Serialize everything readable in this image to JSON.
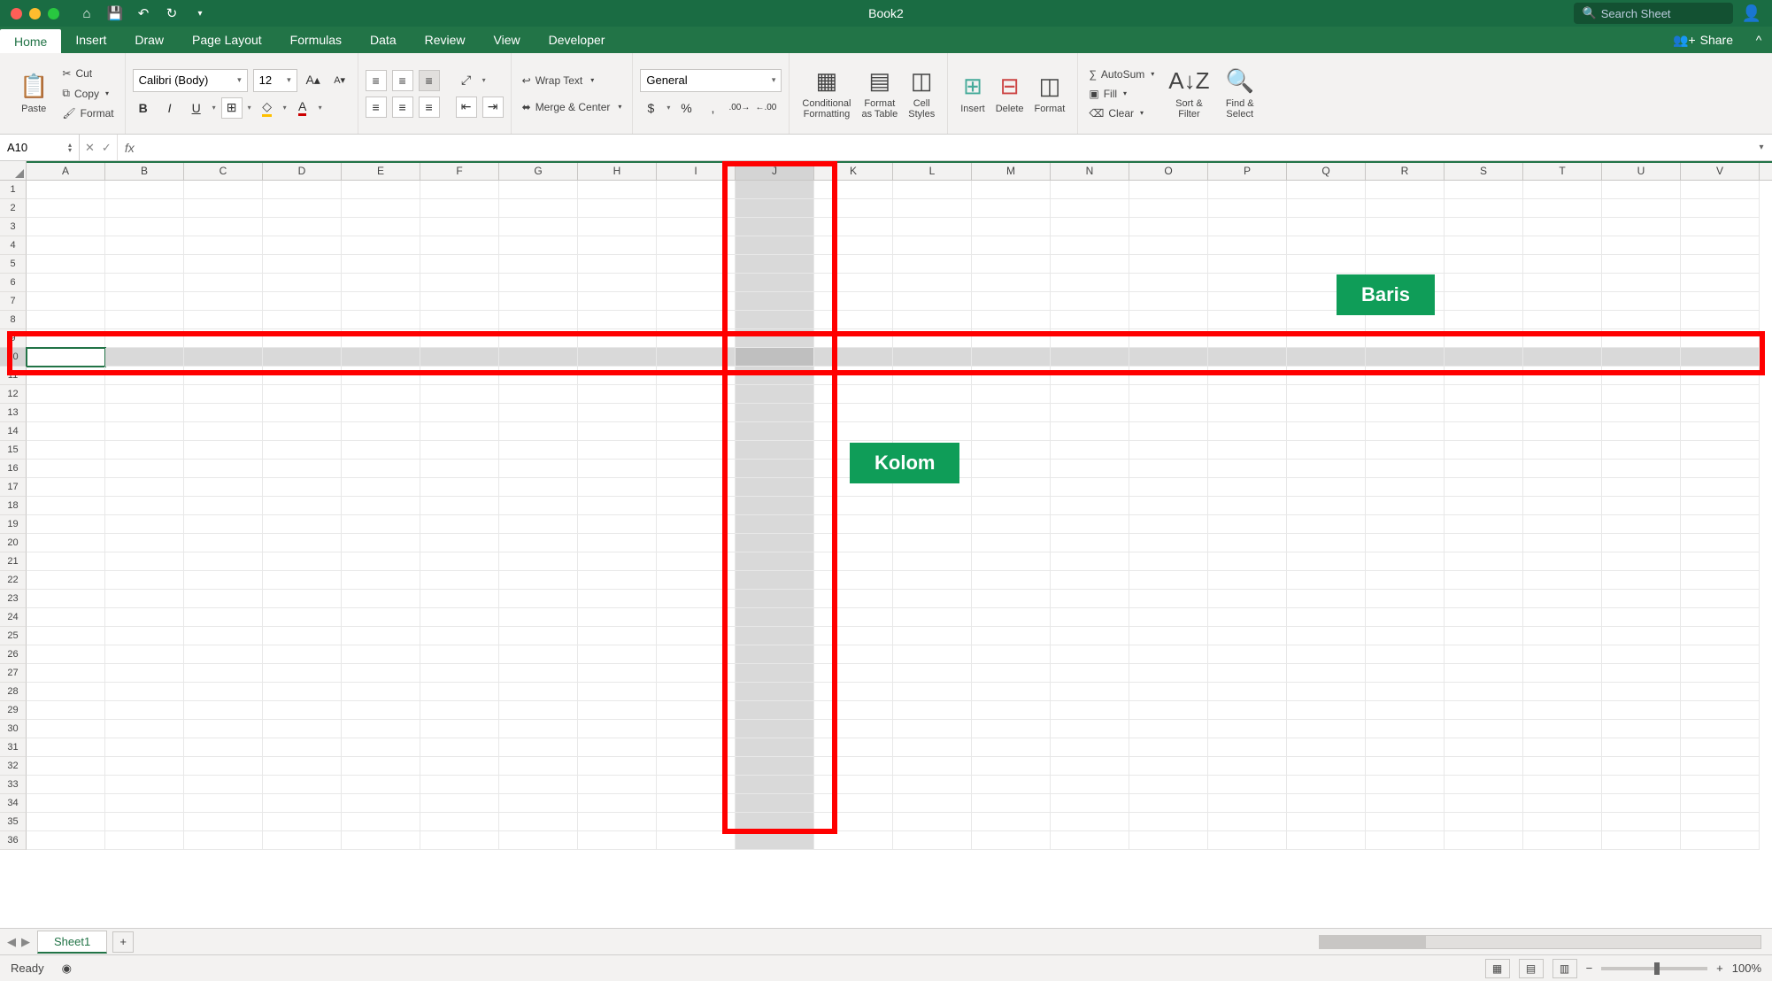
{
  "title_bar": {
    "doc_title": "Book2",
    "search_placeholder": "Search Sheet"
  },
  "ribbon_tabs": {
    "tabs": [
      "Home",
      "Insert",
      "Draw",
      "Page Layout",
      "Formulas",
      "Data",
      "Review",
      "View",
      "Developer"
    ],
    "active": "Home",
    "share": "Share"
  },
  "ribbon": {
    "clipboard": {
      "paste": "Paste",
      "cut": "Cut",
      "copy": "Copy",
      "format": "Format"
    },
    "font": {
      "name": "Calibri (Body)",
      "size": "12"
    },
    "alignment": {
      "wrap": "Wrap Text",
      "merge": "Merge & Center"
    },
    "number": {
      "format": "General"
    },
    "styles": {
      "conditional": "Conditional\nFormatting",
      "format_table": "Format\nas Table",
      "cell_styles": "Cell\nStyles"
    },
    "cells": {
      "insert": "Insert",
      "delete": "Delete",
      "format": "Format"
    },
    "editing": {
      "autosum": "AutoSum",
      "fill": "Fill",
      "clear": "Clear",
      "sort": "Sort &\nFilter",
      "find": "Find &\nSelect"
    }
  },
  "formula_bar": {
    "name_box": "A10",
    "fx": "fx"
  },
  "grid": {
    "columns": [
      "A",
      "B",
      "C",
      "D",
      "E",
      "F",
      "G",
      "H",
      "I",
      "J",
      "K",
      "L",
      "M",
      "N",
      "O",
      "P",
      "Q",
      "R",
      "S",
      "T",
      "U",
      "V"
    ],
    "rows": 36,
    "selected_column": "J",
    "selected_row": 10,
    "active_cell": "A10"
  },
  "annotations": {
    "row_label": "Baris",
    "col_label": "Kolom"
  },
  "sheet_tabs": {
    "sheets": [
      "Sheet1"
    ]
  },
  "status_bar": {
    "ready": "Ready",
    "zoom": "100%"
  }
}
